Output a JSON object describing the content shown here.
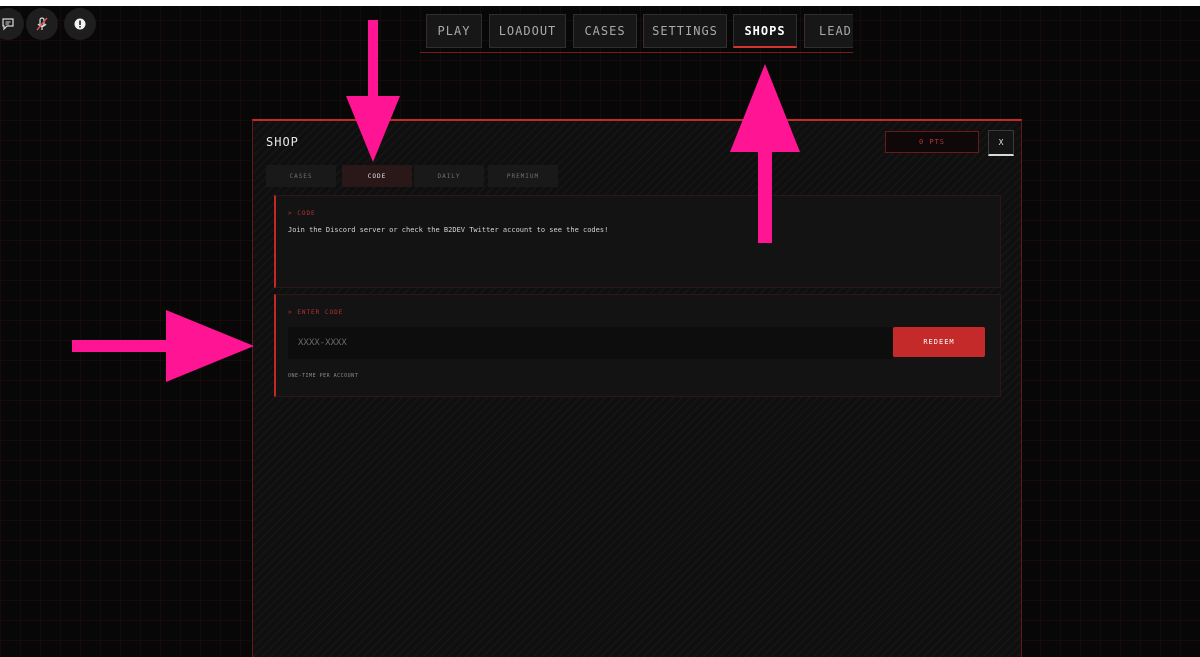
{
  "nav": {
    "items": [
      {
        "label": "PLAY"
      },
      {
        "label": "LOADOUT"
      },
      {
        "label": "CASES"
      },
      {
        "label": "SETTINGS"
      },
      {
        "label": "SHOPS"
      },
      {
        "label": "LEADE"
      }
    ],
    "active": "SHOPS"
  },
  "shop": {
    "title": "SHOP",
    "points": "0 PTS",
    "close_label": "X",
    "tabs": [
      {
        "label": "CASES"
      },
      {
        "label": "CODE"
      },
      {
        "label": "DAILY"
      },
      {
        "label": "PREMIUM"
      }
    ],
    "active_tab": "CODE",
    "info_card": {
      "label": "> CODE",
      "text": "Join the Discord server or check the B2DEV Twitter account to see the codes!"
    },
    "redeem_card": {
      "label": "> ENTER CODE",
      "input_placeholder": "XXXX-XXXX",
      "input_value": "",
      "button_label": "REDEEM",
      "note": "ONE-TIME PER ACCOUNT"
    }
  },
  "icons": {
    "corner": [
      "chat-icon",
      "mic-muted-icon",
      "alert-icon"
    ]
  },
  "colors": {
    "accent": "#c62828",
    "annotation": "#ff1493",
    "background": "#070707"
  }
}
